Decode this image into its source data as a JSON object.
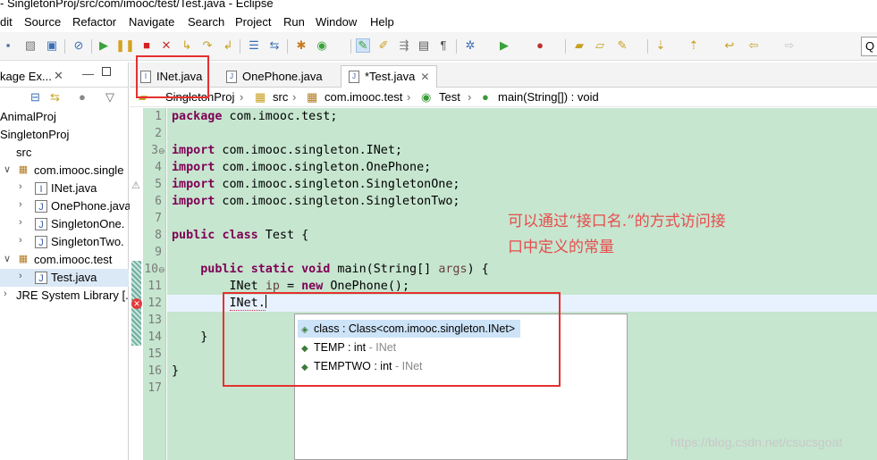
{
  "window": {
    "title": "- SingletonProj/src/com/imooc/test/Test.java - Eclipse"
  },
  "menu": {
    "items": [
      "dit",
      "Source",
      "Refactor",
      "Navigate",
      "Search",
      "Project",
      "Run",
      "Window",
      "Help"
    ]
  },
  "toolbar": {
    "icons": [
      "save-icon",
      "save-all-icon",
      "build-icon",
      "skip-breakpoints-icon",
      "resume-icon",
      "suspend-icon",
      "terminate-icon",
      "disconnect-icon",
      "step-into-icon",
      "step-over-icon",
      "step-return-icon",
      "new-class-icon",
      "open-type-icon",
      "run-as-icon",
      "mark-occurrences-icon",
      "highlight-icon",
      "show-whitespace-icon",
      "task-icon",
      "pilcrow-icon",
      "debug-icon",
      "run-icon",
      "external-tools-icon",
      "open-folder-icon",
      "next-annotation-icon",
      "back-icon",
      "forward-icon"
    ],
    "search_placeholder": "Q"
  },
  "explorer": {
    "title": "kage Ex...",
    "items": [
      {
        "label": "AnimalProj",
        "icon": "project-icon"
      },
      {
        "label": "SingletonProj",
        "icon": "project-icon"
      },
      {
        "label": "src",
        "icon": "source-folder-icon"
      },
      {
        "label": "com.imooc.single",
        "icon": "package-icon"
      },
      {
        "label": "INet.java",
        "icon": "interface-file-icon"
      },
      {
        "label": "OnePhone.java",
        "icon": "java-file-icon"
      },
      {
        "label": "SingletonOne.",
        "icon": "java-file-icon"
      },
      {
        "label": "SingletonTwo.",
        "icon": "java-file-icon"
      },
      {
        "label": "com.imooc.test",
        "icon": "package-icon"
      },
      {
        "label": "Test.java",
        "icon": "java-file-icon"
      },
      {
        "label": "JRE System Library [.",
        "icon": "library-icon"
      }
    ]
  },
  "tabs": [
    {
      "label": "INet.java"
    },
    {
      "label": "OnePhone.java"
    },
    {
      "label": "*Test.java"
    }
  ],
  "breadcrumb": [
    "SingletonProj",
    "src",
    "com.imooc.test",
    "Test",
    "main(String[]) : void"
  ],
  "code": {
    "line_numbers": [
      "1",
      "2",
      "3",
      "4",
      "5",
      "6",
      "7",
      "8",
      "9",
      "10",
      "11",
      "12",
      "13",
      "14",
      "15",
      "16",
      "17"
    ],
    "l1_kw": "package",
    "l1_rest": " com.imooc.test;",
    "l3_kw": "import",
    "l3_rest": " com.imooc.singleton.INet;",
    "l4_kw": "import",
    "l4_rest": " com.imooc.singleton.OnePhone;",
    "l5_kw": "import",
    "l5_rest": " com.imooc.singleton.SingletonOne;",
    "l6_kw": "import",
    "l6_rest": " com.imooc.singleton.SingletonTwo;",
    "l8_kw1": "public",
    "l8_kw2": "class",
    "l8_rest": " Test {",
    "l10_kw1": "public",
    "l10_kw2": "static",
    "l10_kw3": "void",
    "l10_mid": " main(String[] ",
    "l10_arg": "args",
    "l10_end": ") {",
    "l11_a": "INet ",
    "l11_var": "ip",
    "l11_b": " = ",
    "l11_kw": "new",
    "l11_c": " OnePhone();",
    "l12": "INet.",
    "l14": "}",
    "l16": "}"
  },
  "annotation": {
    "line1": "可以通过“接口名.”的方式访问接",
    "line2": "口中定义的常量"
  },
  "autocomplete": {
    "items": [
      {
        "name": "class : Class<com.imooc.singleton.INet>",
        "owner": ""
      },
      {
        "name": "TEMP : int",
        "owner": " - INet"
      },
      {
        "name": "TEMPTWO : int",
        "owner": " - INet"
      }
    ]
  },
  "watermark": "https://blog.csdn.net/csucsgoat",
  "colors": {
    "editor_bg": "#c6e6cf",
    "keyword": "#7f0055",
    "annotation_red": "#e74c4c",
    "highlight_box": "#e53030",
    "selection": "#cde3f8"
  }
}
